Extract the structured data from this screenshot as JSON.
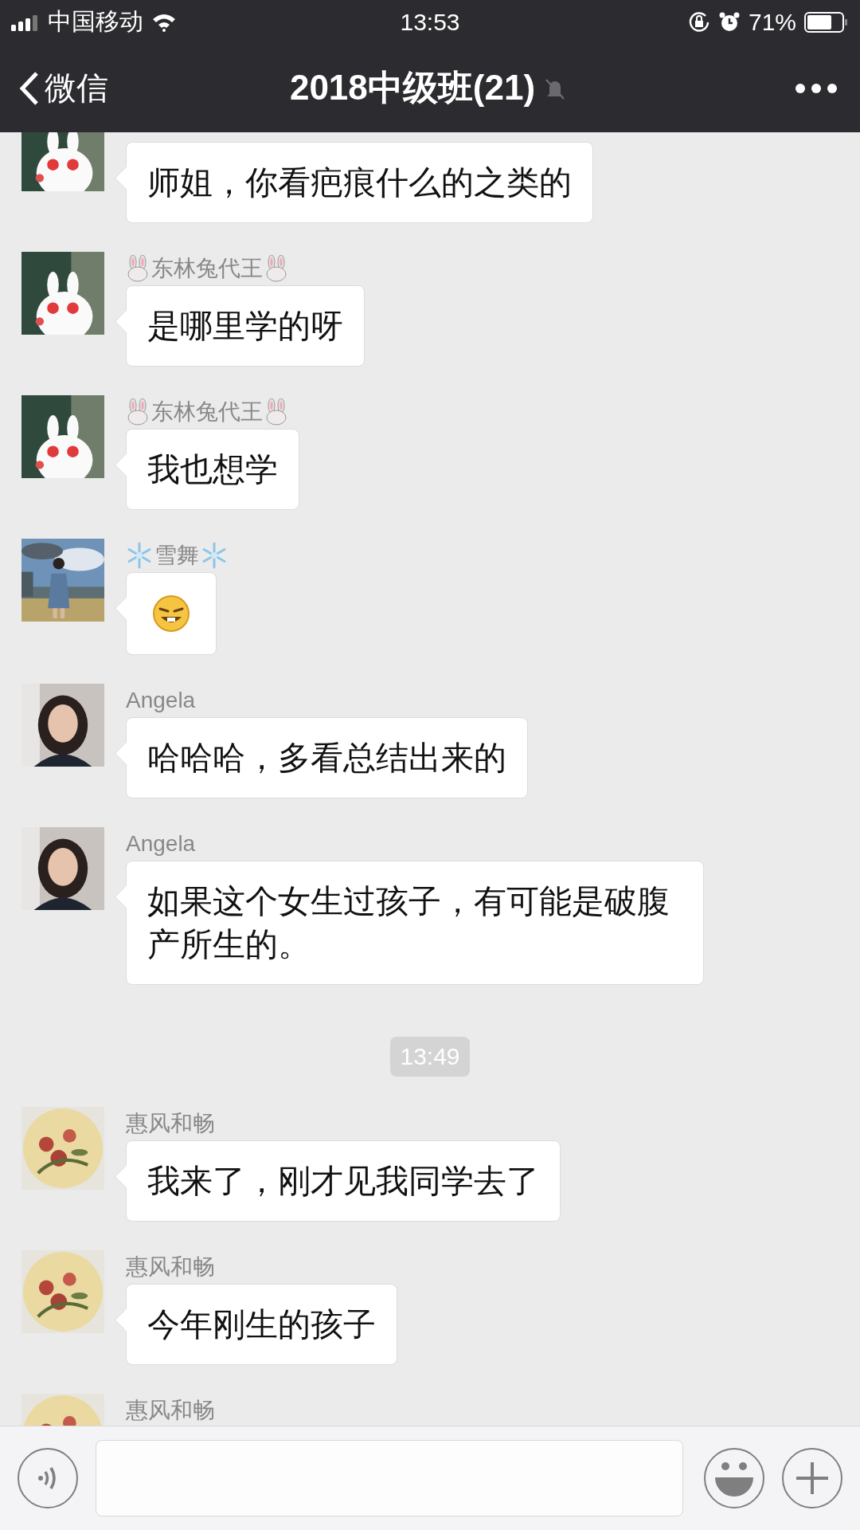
{
  "status_bar": {
    "carrier": "中国移动",
    "time": "13:53",
    "battery": "71%"
  },
  "nav": {
    "back": "微信",
    "title": "2018中级班(21)",
    "muted": true
  },
  "messages": [
    {
      "kind": "text",
      "avatar": {
        "kind": "cartoon"
      },
      "text": "师姐，你看疤痕什么的之类的"
    },
    {
      "kind": "text",
      "avatar": {
        "kind": "cartoon"
      },
      "sender": "东林兔代王",
      "badge": {
        "kind": "rabbit"
      },
      "text": "是哪里学的呀"
    },
    {
      "kind": "text",
      "avatar": {
        "kind": "cartoon"
      },
      "sender": "东林兔代王",
      "badge": {
        "kind": "rabbit"
      },
      "text": "我也想学"
    },
    {
      "kind": "sticker",
      "avatar": {
        "kind": "beach"
      },
      "sender": "雪舞",
      "badge": {
        "kind": "snowflake"
      }
    },
    {
      "kind": "text",
      "avatar": {
        "kind": "selfie"
      },
      "sender": "Angela",
      "text": "哈哈哈，多看总结出来的"
    },
    {
      "kind": "text",
      "avatar": {
        "kind": "selfie"
      },
      "sender": "Angela",
      "text": "如果这个女生过孩子，有可能是破腹产所生的。"
    },
    {
      "kind": "time",
      "text": "13:49"
    },
    {
      "kind": "text",
      "avatar": {
        "kind": "flowers"
      },
      "sender": "惠风和畅",
      "text": "我来了，刚才见我同学去了"
    },
    {
      "kind": "text",
      "avatar": {
        "kind": "flowers"
      },
      "sender": "惠风和畅",
      "text": "今年刚生的孩子"
    },
    {
      "kind": "cut",
      "avatar": {
        "kind": "flowers"
      },
      "sender": "惠风和畅"
    }
  ]
}
